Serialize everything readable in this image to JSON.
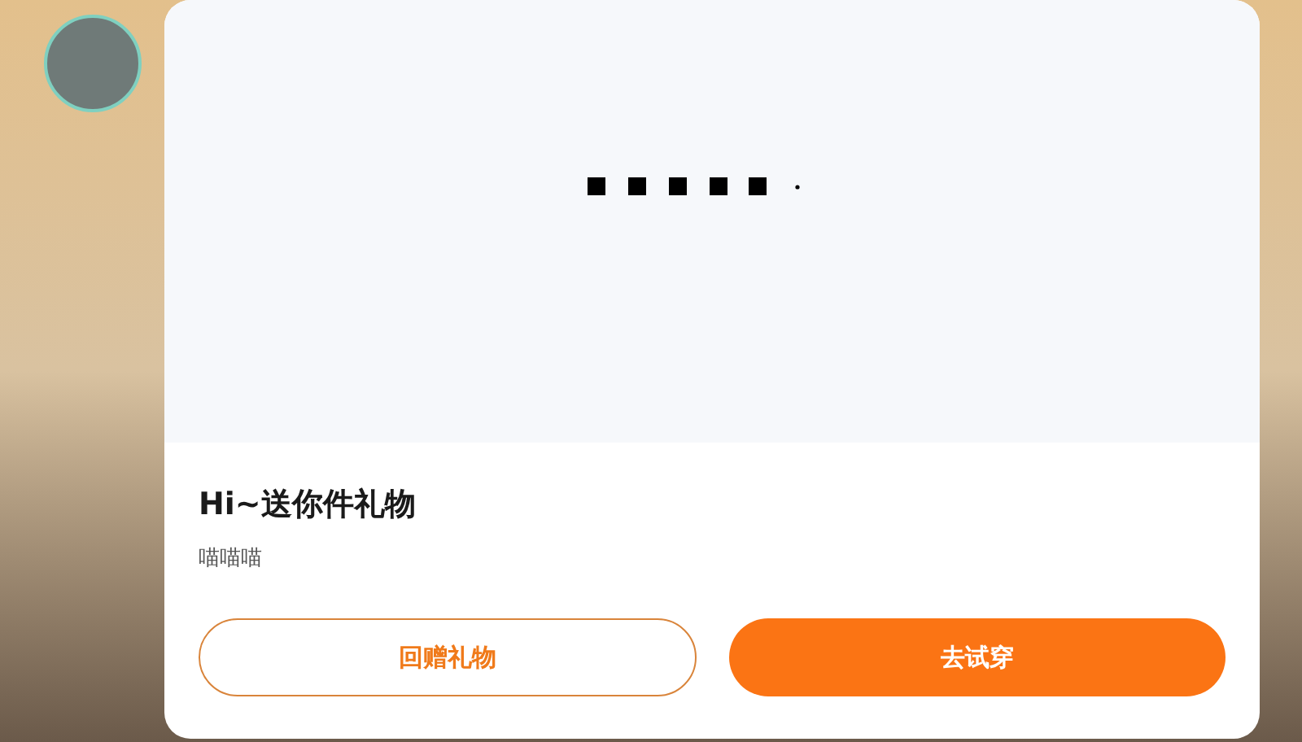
{
  "gift_card": {
    "title": "Hi~送你件礼物",
    "message": "喵喵喵",
    "buttons": [
      {
        "label": "回赠礼物",
        "kind": "outline"
      },
      {
        "label": "去试穿",
        "kind": "filled"
      }
    ]
  }
}
